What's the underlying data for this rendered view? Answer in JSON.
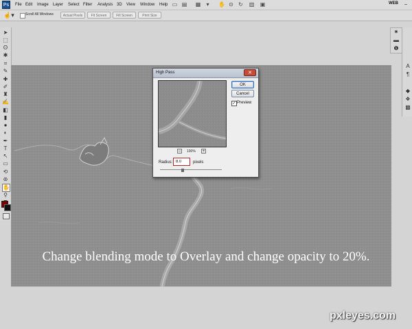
{
  "app": {
    "logo": "Ps",
    "workspace": "WEB"
  },
  "menu": [
    "File",
    "Edit",
    "Image",
    "Layer",
    "Select",
    "Filter",
    "Analysis",
    "3D",
    "View",
    "Window",
    "Help"
  ],
  "options_bar": {
    "scroll_all_windows": "Scroll All Windows",
    "buttons": [
      "Actual Pixels",
      "Fit Screen",
      "Fill Screen",
      "Print Size"
    ]
  },
  "dialog": {
    "title": "High Pass",
    "ok": "OK",
    "cancel": "Cancel",
    "preview_label": "Preview",
    "preview_checked": true,
    "zoom_level": "100%",
    "radius_label": "Radius:",
    "radius_value": "8.0",
    "radius_unit": "pixels"
  },
  "caption": "Change blending mode to Overlay and change opacity to 20%.",
  "watermark": "pxleyes.com",
  "colors": {
    "foreground": "#7a0000",
    "background": "#111111",
    "canvas": "#8f8f8f",
    "radius_highlight": "#b3272a"
  }
}
